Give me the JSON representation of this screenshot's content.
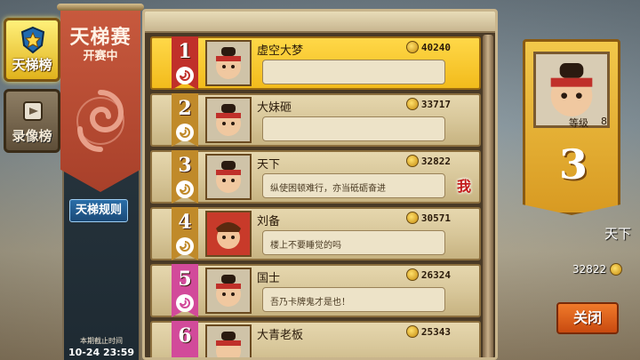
{
  "tabs": [
    {
      "label": "天梯榜",
      "active": true,
      "icon": "trophy-shield-icon"
    },
    {
      "label": "录像榜",
      "active": false,
      "icon": "replay-scroll-icon"
    }
  ],
  "banner": {
    "title": "天梯赛",
    "status": "开赛中",
    "rules_button": "天梯规则",
    "deadline_label": "本期截止时间",
    "deadline_time": "10-24 23:59"
  },
  "list": {
    "rows": [
      {
        "rank": "1",
        "name": "虚空大梦",
        "score": "40240",
        "message": "",
        "is_me": false,
        "ribbon_color": "#c0302a"
      },
      {
        "rank": "2",
        "name": "大妹砸",
        "score": "33717",
        "message": "",
        "is_me": false,
        "ribbon_color": "#c08a2a"
      },
      {
        "rank": "3",
        "name": "天下",
        "score": "32822",
        "message": "纵使困顿难行，亦当砥砺奋进",
        "is_me": true,
        "ribbon_color": "#c08a2a"
      },
      {
        "rank": "4",
        "name": "刘备",
        "score": "30571",
        "message": "楼上不要睡觉的吗",
        "is_me": false,
        "ribbon_color": "#c08a2a"
      },
      {
        "rank": "5",
        "name": "国士",
        "score": "26324",
        "message": "吾乃卡牌鬼才是也！",
        "is_me": false,
        "ribbon_color": "#d24a9a"
      },
      {
        "rank": "6",
        "name": "大青老板",
        "score": "25343",
        "message": "",
        "is_me": false,
        "ribbon_color": "#d24a9a"
      }
    ],
    "me_badge": "我"
  },
  "self": {
    "level_label": "等级",
    "level": "8",
    "rank": "3",
    "name": "天下",
    "score": "32822",
    "close_button": "关闭"
  },
  "colors": {
    "gold": "#f2bb1c",
    "banner_red": "#c85a3e",
    "rules_blue": "#1b4a78",
    "close_orange": "#e06420"
  }
}
